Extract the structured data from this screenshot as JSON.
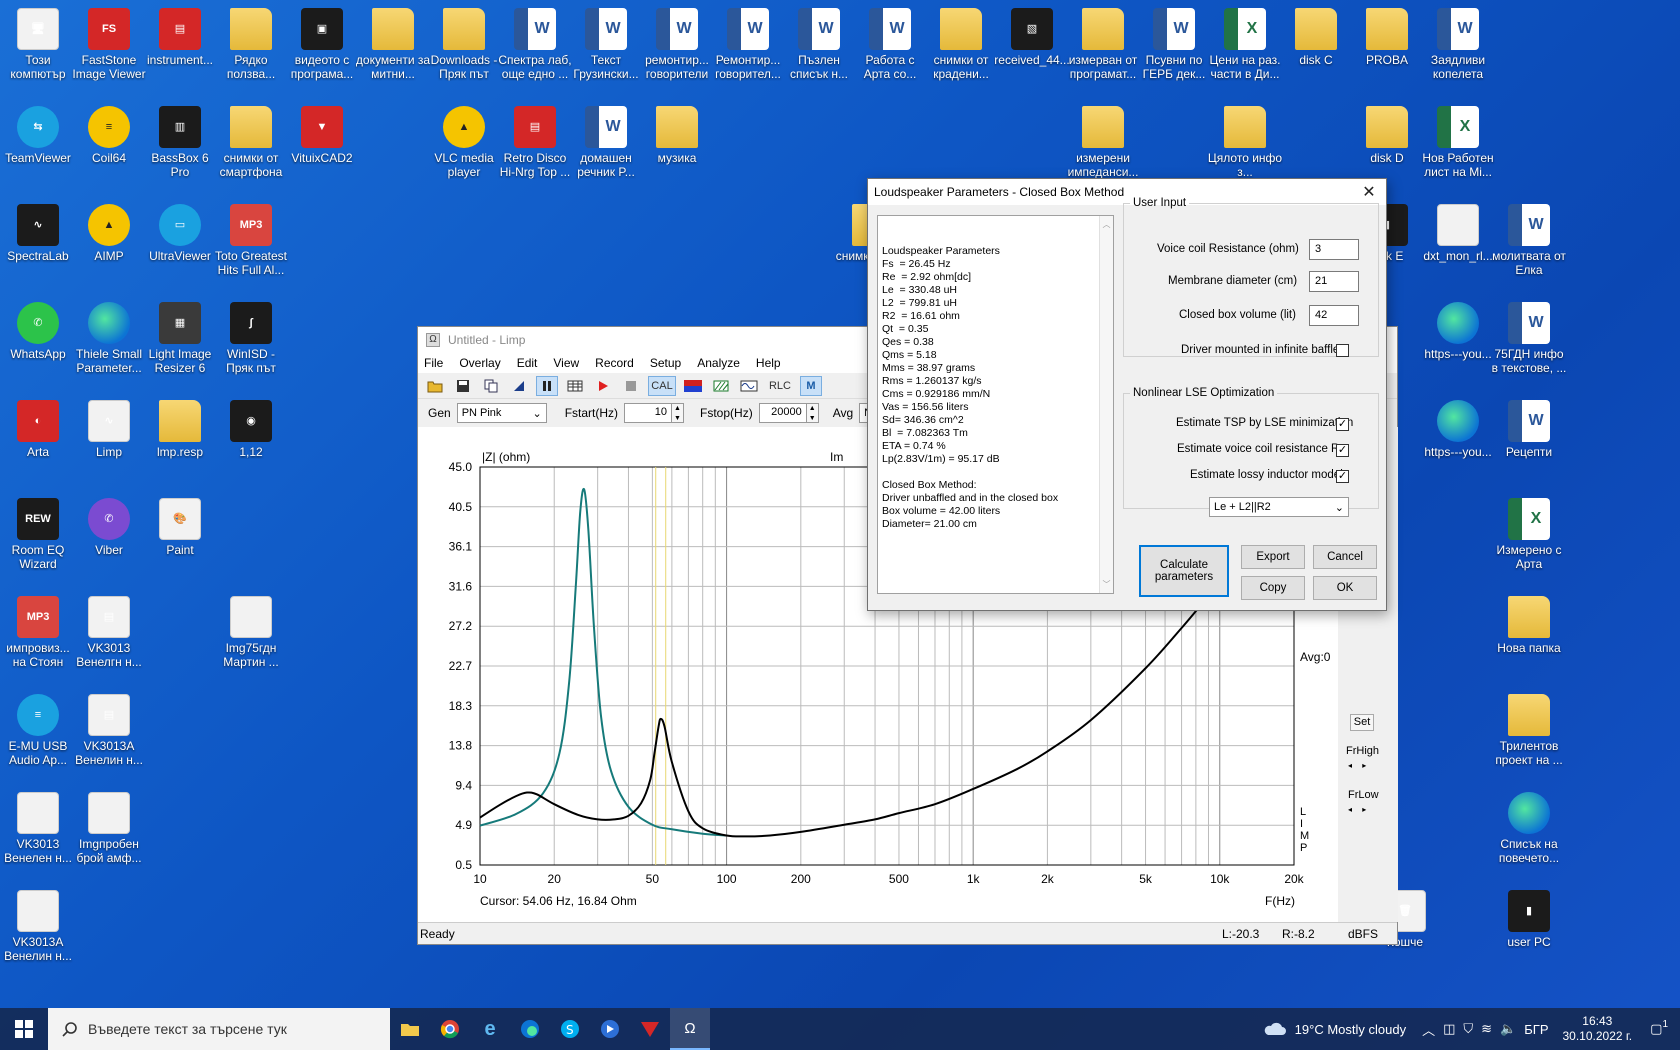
{
  "desktop": {
    "icons": [
      {
        "label": "Този компютър",
        "x": 0,
        "y": 0,
        "kind": "white",
        "glyph": "🖥"
      },
      {
        "label": "FastStone Image Viewer",
        "kind": "red",
        "glyph": "FS"
      },
      {
        "label": "instrument...",
        "kind": "red",
        "glyph": "▤"
      },
      {
        "label": "Рядко ползва...",
        "kind": "folder",
        "glyph": ""
      },
      {
        "label": "видеото с програма...",
        "kind": "dark",
        "glyph": "▣"
      },
      {
        "label": "документи за митни...",
        "kind": "folder",
        "glyph": ""
      },
      {
        "label": "Downloads - Пряк път",
        "kind": "folder",
        "glyph": ""
      },
      {
        "label": "Спектра лаб, още едно ...",
        "kind": "word",
        "glyph": "W"
      },
      {
        "label": "Текст Грузински...",
        "kind": "word",
        "glyph": "W"
      },
      {
        "label": "ремонтир... говорители",
        "kind": "word",
        "glyph": "W"
      },
      {
        "label": "Ремонтир... говорител...",
        "kind": "word",
        "glyph": "W"
      },
      {
        "label": "Пъзлен списък н...",
        "kind": "word",
        "glyph": "W"
      },
      {
        "label": "Работа с Арта со...",
        "kind": "word",
        "glyph": "W"
      },
      {
        "label": "снимки от крадени...",
        "kind": "folder",
        "glyph": ""
      },
      {
        "label": "received_44...",
        "kind": "dark",
        "glyph": "▧"
      },
      {
        "label": "измерван от програмат...",
        "kind": "folder",
        "glyph": ""
      },
      {
        "label": "Псувни по ГЕРБ дек...",
        "kind": "word",
        "glyph": "W"
      },
      {
        "label": "Цени на раз. части в Ди...",
        "kind": "excel",
        "glyph": "X"
      },
      {
        "label": "disk C",
        "kind": "folder",
        "glyph": ""
      },
      {
        "label": "PROBA",
        "kind": "folder",
        "glyph": ""
      },
      {
        "label": "Заядливи копелета",
        "kind": "word",
        "glyph": "W"
      },
      {
        "label": "TeamViewer",
        "kind": "teal",
        "glyph": "⇆"
      },
      {
        "label": "Coil64",
        "kind": "yellow",
        "glyph": "≡"
      },
      {
        "label": "BassBox 6 Pro",
        "kind": "dark",
        "glyph": "▥"
      },
      {
        "label": "снимки от смартфона",
        "kind": "folder",
        "glyph": ""
      },
      {
        "label": "VituixCAD2",
        "kind": "red",
        "glyph": "▼"
      },
      {
        "label": "VLC media player",
        "kind": "yellow",
        "glyph": "▲"
      },
      {
        "label": "Retro Disco Hi-Nrg Top ...",
        "kind": "red",
        "glyph": "▤"
      },
      {
        "label": "домашен речник P...",
        "kind": "word",
        "glyph": "W"
      },
      {
        "label": "музика",
        "kind": "folder",
        "glyph": ""
      },
      {
        "label": "измерени импеданси...",
        "kind": "folder",
        "glyph": ""
      },
      {
        "label": "Цялото инфо з...",
        "kind": "folder",
        "glyph": ""
      },
      {
        "label": "disk D",
        "kind": "folder",
        "glyph": ""
      },
      {
        "label": "Нов Работен лист на Mi...",
        "kind": "excel",
        "glyph": "X"
      },
      {
        "label": "SpectraLab",
        "kind": "dark",
        "glyph": "∿"
      },
      {
        "label": "AIMP",
        "kind": "yellow",
        "glyph": "▲"
      },
      {
        "label": "UltraViewer",
        "kind": "teal",
        "glyph": "▭"
      },
      {
        "label": "Toto Greatest Hits Full Al...",
        "kind": "mp3",
        "glyph": "MP3"
      },
      {
        "label": "снимки 10 Г...",
        "kind": "folder",
        "glyph": ""
      },
      {
        "label": "disk E",
        "kind": "dark",
        "glyph": "▮"
      },
      {
        "label": "dxt_mon_rl...",
        "kind": "white",
        "glyph": ""
      },
      {
        "label": "молитвата от Елка",
        "kind": "word",
        "glyph": "W"
      },
      {
        "label": "WhatsApp",
        "kind": "green",
        "glyph": "✆"
      },
      {
        "label": "Thiele Small Parameter...",
        "kind": "edge",
        "glyph": ""
      },
      {
        "label": "Light Image Resizer 6",
        "kind": "app",
        "glyph": "▦"
      },
      {
        "label": "WinISD - Пряк път",
        "kind": "dark",
        "glyph": "∫"
      },
      {
        "label": "https---you...",
        "kind": "edge",
        "glyph": ""
      },
      {
        "label": "75ГДН инфо в текстове, ...",
        "kind": "word",
        "glyph": "W"
      },
      {
        "label": "Arta",
        "kind": "red",
        "glyph": "◐"
      },
      {
        "label": "Limp",
        "kind": "white",
        "glyph": "∿"
      },
      {
        "label": "lmp.resp",
        "kind": "folder",
        "glyph": ""
      },
      {
        "label": "1,12",
        "kind": "dark",
        "glyph": "◉"
      },
      {
        "label": "https---you...",
        "kind": "edge",
        "glyph": ""
      },
      {
        "label": "Рецепти",
        "kind": "word",
        "glyph": "W"
      },
      {
        "label": "Room EQ Wizard",
        "kind": "dark",
        "glyph": "REW"
      },
      {
        "label": "Viber",
        "kind": "purple",
        "glyph": "✆"
      },
      {
        "label": "Paint",
        "kind": "white",
        "glyph": "🎨"
      },
      {
        "label": "Измерено с Арта",
        "kind": "excel",
        "glyph": "X"
      },
      {
        "label": "импровиз... на Стоян",
        "kind": "mp3",
        "glyph": "MP3"
      },
      {
        "label": "VK3013 Венелгн н...",
        "kind": "white",
        "glyph": "▤"
      },
      {
        "label": "Img75гдн Мартин ...",
        "kind": "white",
        "glyph": ""
      },
      {
        "label": "Нова папка",
        "kind": "folder",
        "glyph": ""
      },
      {
        "label": "E-MU USB Audio Ap...",
        "kind": "teal",
        "glyph": "≡"
      },
      {
        "label": "VK3013A Венелин н...",
        "kind": "white",
        "glyph": "▤"
      },
      {
        "label": "Трилентов проект на ...",
        "kind": "folder",
        "glyph": ""
      },
      {
        "label": "VK3013 Венелен н...",
        "kind": "white",
        "glyph": ""
      },
      {
        "label": "Imgпробен брой амф...",
        "kind": "white",
        "glyph": ""
      },
      {
        "label": "Списък на повечето...",
        "kind": "edge",
        "glyph": ""
      },
      {
        "label": "VK3013A Венелин н...",
        "kind": "white",
        "glyph": ""
      },
      {
        "label": "Кошче",
        "kind": "white",
        "glyph": "🗑"
      },
      {
        "label": "user PC",
        "kind": "dark",
        "glyph": "▮"
      }
    ]
  },
  "limp": {
    "title": "Untitled - Limp",
    "app_icon": "Ω",
    "menu": [
      "File",
      "Overlay",
      "Edit",
      "View",
      "Record",
      "Setup",
      "Analyze",
      "Help"
    ],
    "gen_label": "Gen",
    "gen_value": "PN Pink",
    "fstart_label": "Fstart(Hz)",
    "fstart_value": "10",
    "fstop_label": "Fstop(Hz)",
    "fstop_value": "20000",
    "avg_label": "Avg",
    "avg_value": "N",
    "cal_label": "CAL",
    "rlc_label": "RLC",
    "m_label": "M",
    "plot": {
      "y_title": "|Z| (ohm)",
      "right_title": "Im",
      "cursor": "Cursor: 54.06 Hz, 16.84 Ohm",
      "x_unit": "F(Hz)",
      "limp_vertical": [
        "L",
        "I",
        "M",
        "P"
      ],
      "avg_text": "Avg:0",
      "set_label": "Set",
      "frhigh_label": "FrHigh",
      "frlow_label": "FrLow"
    },
    "status": {
      "ready": "Ready",
      "l": "L:-20.3",
      "r": "R:-8.2",
      "unit": "dBFS"
    }
  },
  "chart_data": {
    "type": "line",
    "title": "",
    "xlabel": "F(Hz)",
    "ylabel": "|Z| (ohm)",
    "x_scale": "log",
    "xlim": [
      10,
      20000
    ],
    "ylim": [
      0.5,
      45.0
    ],
    "x_ticks": [
      "10",
      "20",
      "50",
      "100",
      "200",
      "500",
      "1k",
      "2k",
      "5k",
      "10k",
      "20k"
    ],
    "y_ticks": [
      "45.0",
      "40.5",
      "36.1",
      "31.6",
      "27.2",
      "22.7",
      "18.3",
      "13.8",
      "9.4",
      "4.9",
      "0.5"
    ],
    "series": [
      {
        "color": "#167a7a",
        "x": [
          10,
          14,
          18,
          21,
          23,
          24.5,
          25.5,
          26.45,
          27.5,
          29,
          31,
          34,
          40,
          50,
          60,
          80,
          100
        ],
        "y": [
          4.9,
          6.2,
          8.5,
          13.0,
          21.0,
          32.0,
          40.0,
          42.5,
          38.0,
          27.0,
          17.0,
          11.0,
          7.0,
          5.0,
          4.5,
          4.0,
          3.8
        ]
      },
      {
        "color": "#000000",
        "x": [
          10,
          12,
          14,
          15.5,
          17,
          20,
          25,
          30,
          35,
          40,
          45,
          49,
          51,
          53,
          54.06,
          56,
          60,
          70,
          80,
          100,
          120,
          150,
          200,
          300,
          400,
          500,
          700,
          1000,
          1500,
          2000,
          3000,
          5000,
          7000,
          10000,
          15000,
          20000
        ],
        "y": [
          5.8,
          7.2,
          8.2,
          8.6,
          8.4,
          7.3,
          6.1,
          5.6,
          5.6,
          6.0,
          7.4,
          10.0,
          13.0,
          16.0,
          16.84,
          16.0,
          12.0,
          6.5,
          4.6,
          3.8,
          3.7,
          3.8,
          4.2,
          5.0,
          5.6,
          6.3,
          7.3,
          9.0,
          11.2,
          13.2,
          16.7,
          22.5,
          27.0,
          32.0,
          37.0,
          41.0
        ]
      }
    ],
    "cursor_x": 54.06
  },
  "dialog": {
    "title": "Loudspeaker Parameters - Closed Box Method",
    "text_lines": [
      "Loudspeaker Parameters",
      "Fs  = 26.45 Hz",
      "Re  = 2.92 ohm[dc]",
      "Le  = 330.48 uH",
      "L2  = 799.81 uH",
      "R2  = 16.61 ohm",
      "Qt  = 0.35",
      "Qes = 0.38",
      "Qms = 5.18",
      "Mms = 38.97 grams",
      "Rms = 1.260137 kg/s",
      "Cms = 0.929186 mm/N",
      "Vas = 156.56 liters",
      "Sd= 346.36 cm^2",
      "Bl  = 7.082363 Tm",
      "ETA = 0.74 %",
      "Lp(2.83V/1m) = 95.17 dB",
      "",
      "Closed Box Method:",
      "Driver unbaffled and in the closed box",
      "Box volume = 42.00 liters",
      "Diameter= 21.00 cm"
    ],
    "user_input_legend": "User Input",
    "voice_coil_label": "Voice coil Resistance (ohm)",
    "voice_coil_value": "3",
    "membrane_label": "Membrane diameter (cm)",
    "membrane_value": "21",
    "box_volume_label": "Closed box volume (lit)",
    "box_volume_value": "42",
    "infinite_baffle_label": "Driver mounted in infinite baffle",
    "infinite_baffle_checked": false,
    "nonlinear_legend": "Nonlinear LSE Optimization",
    "estimate_tsp_label": "Estimate TSP by LSE minimization",
    "estimate_re_label": "Estimate voice coil resistance Re",
    "estimate_lossy_label": "Estimate lossy inductor model",
    "model_value": "Le + L2||R2",
    "calculate_label": "Calculate parameters",
    "export_label": "Export",
    "cancel_label": "Cancel",
    "copy_label": "Copy",
    "ok_label": "OK",
    "check_mark": "✓"
  },
  "taskbar": {
    "search_placeholder": "Въведете текст за търсене тук",
    "weather": "19°C  Mostly cloudy",
    "lang": "БГР",
    "time": "16:43",
    "date": "30.10.2022 г.",
    "notifications": "1"
  }
}
